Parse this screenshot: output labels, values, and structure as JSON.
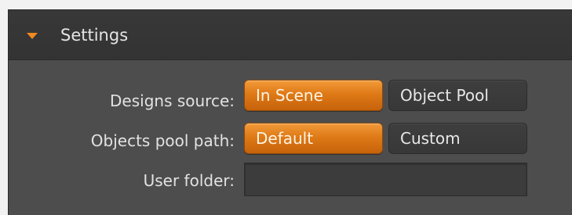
{
  "header": {
    "title": "Settings",
    "expand_icon": "triangle-down-icon"
  },
  "designs_source": {
    "label": "Designs source:",
    "options": [
      "In Scene",
      "Object Pool"
    ],
    "selected": "In Scene"
  },
  "objects_pool_path": {
    "label": "Objects pool path:",
    "options": [
      "Default",
      "Custom"
    ],
    "selected": "Default"
  },
  "user_folder": {
    "label": "User folder:",
    "value": ""
  },
  "colors": {
    "accent": "#e0801d",
    "panel_bg": "#4d4d4d",
    "header_bg": "#353535"
  }
}
